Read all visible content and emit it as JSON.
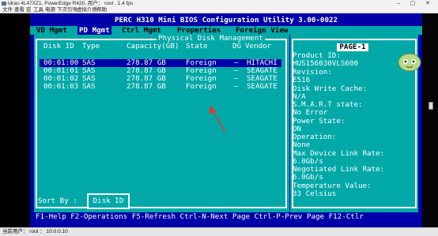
{
  "window": {
    "title": "idrac-4L47XZ1, PowerEdge R420, 用户： root , 1.4 fps",
    "controls": {
      "minimize": "–",
      "maximize": "▢",
      "close": "✕"
    }
  },
  "menubar": {
    "items": [
      "文件",
      "查看",
      "宏",
      "工具",
      "电源",
      "下次引导",
      "虚拟介质",
      "帮助"
    ]
  },
  "bios": {
    "heading": "PERC H310 Mini BIOS Configuration Utility 3.00-0022",
    "tabs": [
      "VD Mgmt",
      "PD Mgmt",
      "Ctrl Mgmt",
      "Properties",
      "Foreign View"
    ],
    "active_tab": 1,
    "panel_title": "Physical Disk Management",
    "columns": [
      "Disk ID",
      "Type",
      "Capacity(GB)",
      "State",
      "DG",
      "Vendor"
    ],
    "rows": [
      {
        "id": "00:01:00",
        "type": "SAS",
        "capacity": "278.87 GB",
        "state": "Foreign",
        "dg": "–",
        "vendor": "HITACHI"
      },
      {
        "id": "00:01:01",
        "type": "SAS",
        "capacity": "278.87 GB",
        "state": "Foreign",
        "dg": "–",
        "vendor": "SEAGATE"
      },
      {
        "id": "00:01:02",
        "type": "SAS",
        "capacity": "278.87 GB",
        "state": "Foreign",
        "dg": "–",
        "vendor": "SEAGATE"
      },
      {
        "id": "00:01:03",
        "type": "SAS",
        "capacity": "278.87 GB",
        "state": "Foreign",
        "dg": "–",
        "vendor": "SEAGATE"
      }
    ],
    "selected_row": 0,
    "sort_label": "Sort By :",
    "sort_button": "Disk ID",
    "page": "PAGE-1",
    "properties": [
      {
        "label": "Product ID:",
        "value": "HUS156030VLS600"
      },
      {
        "label": "Revision:",
        "value": "E516"
      },
      {
        "label": "Disk Write Cache:",
        "value": "N/A"
      },
      {
        "label": "S.M.A.R.T state:",
        "value": "No Error"
      },
      {
        "label": "Power State:",
        "value": "ON"
      },
      {
        "label": "Operation:",
        "value": "None"
      },
      {
        "label": "Max Device Link Rate:",
        "value": "6.0Gb/s"
      },
      {
        "label": "Negotiated Link Rate:",
        "value": "6.0Gb/s"
      },
      {
        "label": "Temperature Value:",
        "value": "33 Celsius"
      }
    ],
    "help": "F1-Help F2-Operations F5-Refresh Ctrl-N-Next Page Ctrl-P-Prev Page F12-Ctlr"
  },
  "statusbar": {
    "text": "当前用户： root ： 10.0.0.10"
  },
  "colors": {
    "bios_blue": "#0000a8",
    "bios_cyan": "#00a8a8",
    "annotation_arrow": "#e03a2f"
  }
}
